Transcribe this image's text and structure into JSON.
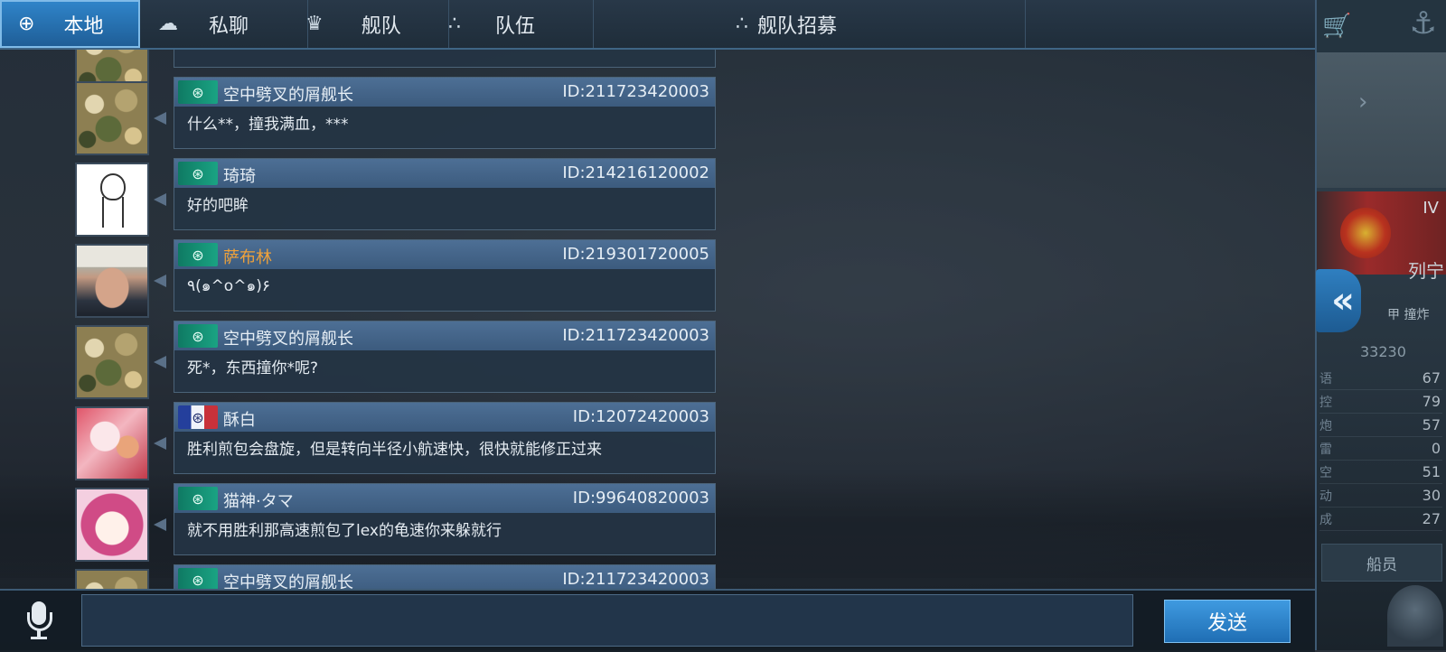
{
  "tabs": [
    {
      "icon": "globe-icon",
      "glyph": "⊕",
      "label": "本地",
      "active": true
    },
    {
      "icon": "speech-bubble-icon",
      "glyph": "☁",
      "label": "私聊",
      "active": false
    },
    {
      "icon": "fleet-emblem-icon",
      "glyph": "♛",
      "label": "舰队",
      "active": false
    },
    {
      "icon": "team-dots-icon",
      "glyph": "∴",
      "label": "队伍",
      "active": false
    },
    {
      "icon": "recruit-dots-icon",
      "glyph": "∴",
      "label": "舰队招募",
      "active": false
    }
  ],
  "messages": [
    {
      "sender": "空中劈叉的屑舰长",
      "id": "ID:211723420003",
      "text": "什么**，撞我满血，***",
      "badge": "china"
    },
    {
      "sender": "琦琦",
      "id": "ID:214216120002",
      "text": "好的吧眸",
      "badge": "china"
    },
    {
      "sender": "萨布林",
      "id": "ID:219301720005",
      "text": "٩(๑^o^๑)۶",
      "badge": "china",
      "highlight": true
    },
    {
      "sender": "空中劈叉的屑舰长",
      "id": "ID:211723420003",
      "text": "死*，东西撞你*呢?",
      "badge": "china"
    },
    {
      "sender": "酥白",
      "id": "ID:12072420003",
      "text": "胜利煎包会盘旋，但是转向半径小航速快，很快就能修正过来",
      "badge": "france"
    },
    {
      "sender": "猫神·タマ",
      "id": "ID:99640820003",
      "text": "就不用胜利那高速煎包了lex的龟速你来躲就行",
      "badge": "china"
    },
    {
      "sender": "空中劈叉的屑舰长",
      "id": "ID:211723420003",
      "text": "",
      "badge": "china"
    }
  ],
  "input": {
    "value": "",
    "placeholder": ""
  },
  "send_label": "发送",
  "side": {
    "ship_tier": "IV",
    "ship_name": "列宁",
    "power": "33230",
    "labels": "甲 撞炸",
    "stats": [
      {
        "k": "语",
        "v": "67"
      },
      {
        "k": "控",
        "v": "79"
      },
      {
        "k": "炮",
        "v": "57"
      },
      {
        "k": "雷",
        "v": "0"
      },
      {
        "k": "空",
        "v": "51"
      },
      {
        "k": "动",
        "v": "30"
      },
      {
        "k": "成",
        "v": "27"
      }
    ],
    "crew_label": "船员"
  },
  "colors": {
    "accent": "#2f84c9",
    "bubble_head": "#4d6f95",
    "badge_green": "#1aa383",
    "highlight_name": "#f0a23a"
  }
}
